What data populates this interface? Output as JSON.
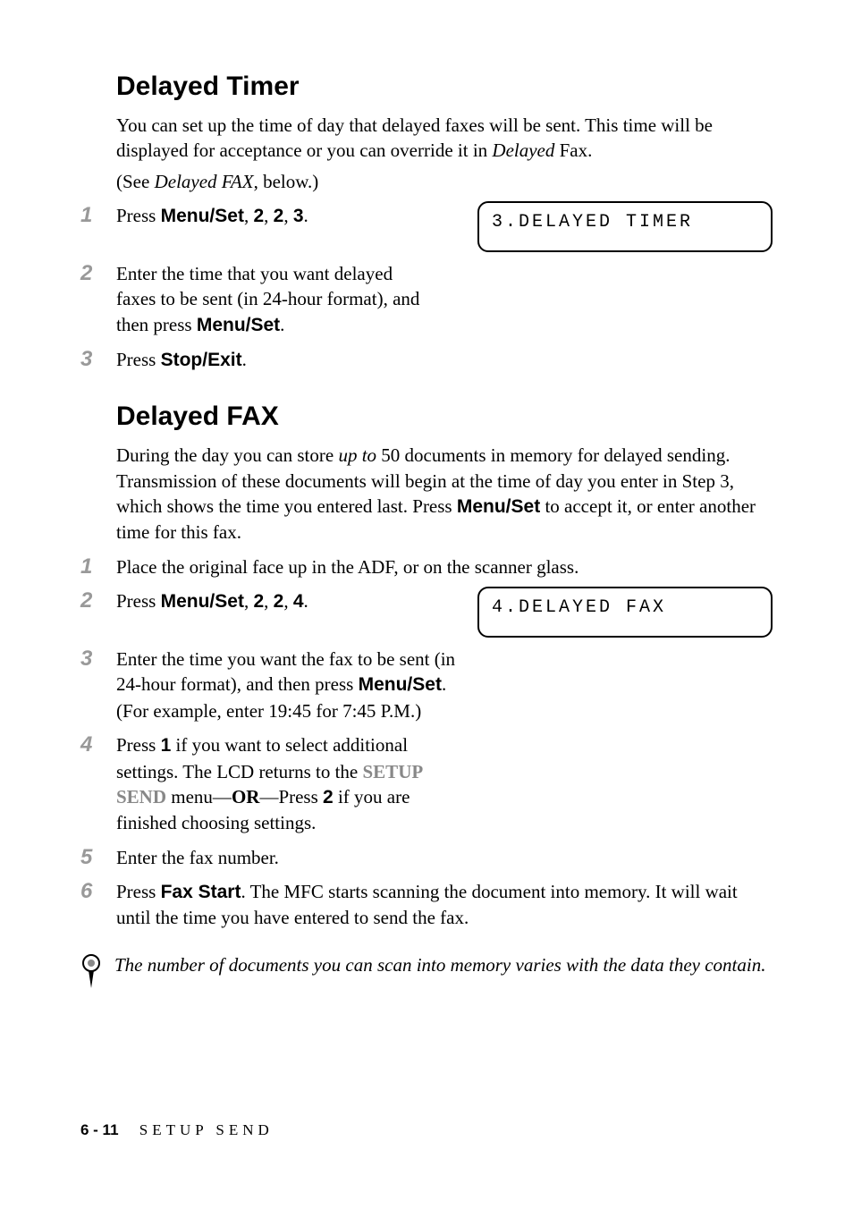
{
  "section1": {
    "heading": "Delayed Timer",
    "intro_plain1": "You can set up the time of day that delayed faxes will be sent. This time will be displayed for acceptance or you can override it in ",
    "intro_ital": "Delayed",
    "intro_plain2": " Fax.",
    "see_open": "(See ",
    "see_ital": "Delayed FAX",
    "see_close": ", below.)",
    "steps": [
      {
        "num": "1",
        "pre": "Press ",
        "bold": "Menu/Set",
        "post": ", ",
        "b2": "2",
        "post2": ", ",
        "b3": "2",
        "post3": ", ",
        "b4": "3",
        "post4": "."
      },
      {
        "num": "2",
        "text1": "Enter the time that you want delayed faxes to be sent (in 24-hour format), and then press ",
        "bold": "Menu/Set",
        "text2": "."
      },
      {
        "num": "3",
        "pre": "Press ",
        "bold": "Stop/Exit",
        "post": "."
      }
    ],
    "lcd": "3.DELAYED TIMER"
  },
  "section2": {
    "heading": "Delayed FAX",
    "intro1": "During the day you can store ",
    "intro_ital": "up to",
    "intro2": " 50 documents in memory for delayed sending. Transmission of these documents will begin at the time of day you enter in Step 3, which shows the time you entered last. Press ",
    "intro_bold": "Menu/Set",
    "intro3": " to accept it, or enter another time for this fax.",
    "steps": [
      {
        "num": "1",
        "text": "Place the original face up in the ADF, or on the scanner glass."
      },
      {
        "num": "2",
        "pre": "Press ",
        "bold": "Menu/Set",
        "post": ", ",
        "b2": "2",
        "post2": ", ",
        "b3": "2",
        "post3": ", ",
        "b4": "4",
        "post4": "."
      },
      {
        "num": "3",
        "text1": "Enter the time you want the fax to be sent (in 24-hour format), and then press ",
        "bold": "Menu/Set",
        "text2": ".",
        "text3": "(For example, enter 19:45 for 7:45 P.M.)"
      },
      {
        "num": "4",
        "pre": "Press ",
        "b1": "1",
        "mid1": " if you want to select additional settings. The LCD returns to the ",
        "setup": "SETUP SEND",
        "mid2": " menu—",
        "or": "OR",
        "mid3": "—Press ",
        "b2": "2",
        "mid4": " if you are finished choosing settings."
      },
      {
        "num": "5",
        "text": "Enter the fax number."
      },
      {
        "num": "6",
        "pre": "Press ",
        "bold": "Fax Start",
        "post": ". The MFC starts scanning the document into memory. It will wait until the time you have entered to send the fax."
      }
    ],
    "lcd": "4.DELAYED FAX"
  },
  "note": "The number of documents you can scan into memory varies with the data they contain.",
  "footer": {
    "page": "6 - 11",
    "section": "SETUP SEND"
  }
}
